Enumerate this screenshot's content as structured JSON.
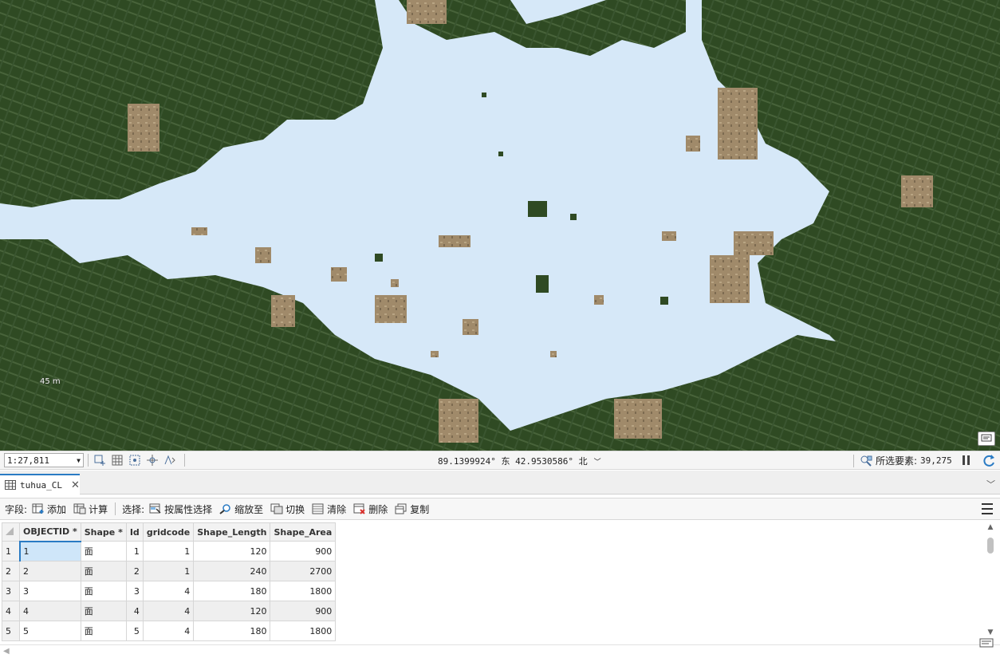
{
  "map": {
    "scale_mark": "45 m",
    "colors": {
      "polygon_fill": "#d6e8f8",
      "vegetation": "#2f4a23",
      "soil": "#a08a6a"
    }
  },
  "statusbar": {
    "scale_value": "1:27,811",
    "coordinates": "89.1399924° 东 42.9530586° 北",
    "selected_label": "所选要素:",
    "selected_count": "39,275"
  },
  "tab": {
    "label": "tuhua_CL"
  },
  "toolbar": {
    "field_label": "字段:",
    "add_label": "添加",
    "calc_label": "计算",
    "select_label": "选择:",
    "select_by_attr_label": "按属性选择",
    "zoom_to_label": "缩放至",
    "switch_label": "切换",
    "clear_label": "清除",
    "delete_label": "删除",
    "copy_label": "复制"
  },
  "table": {
    "columns": [
      "OBJECTID *",
      "Shape *",
      "Id",
      "gridcode",
      "Shape_Length",
      "Shape_Area"
    ],
    "rows": [
      {
        "row": "1",
        "cells": [
          "1",
          "面",
          "1",
          "1",
          "120",
          "900"
        ]
      },
      {
        "row": "2",
        "cells": [
          "2",
          "面",
          "2",
          "1",
          "240",
          "2700"
        ]
      },
      {
        "row": "3",
        "cells": [
          "3",
          "面",
          "3",
          "4",
          "180",
          "1800"
        ]
      },
      {
        "row": "4",
        "cells": [
          "4",
          "面",
          "4",
          "4",
          "120",
          "900"
        ]
      },
      {
        "row": "5",
        "cells": [
          "5",
          "面",
          "5",
          "4",
          "180",
          "1800"
        ]
      }
    ]
  }
}
